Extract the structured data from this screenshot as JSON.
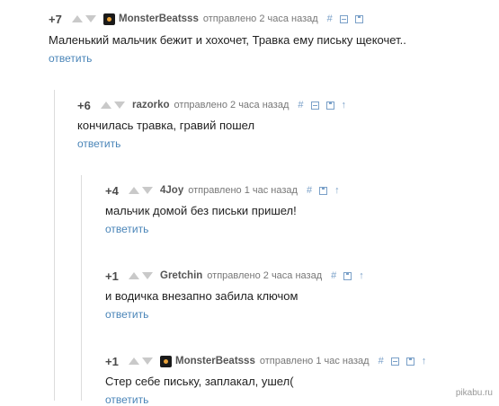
{
  "comments": [
    {
      "score": "+7",
      "author": "MonsterBeatsss",
      "has_avatar": true,
      "meta": "отправлено 2 часа назад",
      "text": "Маленький мальчик бежит и хохочет, Травка ему письку щекочет..",
      "reply": "ответить",
      "tools": [
        "hash",
        "collapse",
        "save"
      ]
    },
    {
      "score": "+6",
      "author": "razorko",
      "has_avatar": false,
      "meta": "отправлено 2 часа назад",
      "text": "кончилась травка, гравий пошел",
      "reply": "ответить",
      "tools": [
        "hash",
        "collapse",
        "save",
        "parent"
      ]
    },
    {
      "score": "+4",
      "author": "4Joy",
      "has_avatar": false,
      "meta": "отправлено 1 час назад",
      "text": "мальчик домой без письки пришел!",
      "reply": "ответить",
      "tools": [
        "hash",
        "save",
        "parent"
      ]
    },
    {
      "score": "+1",
      "author": "Gretchin",
      "has_avatar": false,
      "meta": "отправлено 2 часа назад",
      "text": "и водичка внезапно забила ключом",
      "reply": "ответить",
      "tools": [
        "hash",
        "save",
        "parent"
      ]
    },
    {
      "score": "+1",
      "author": "MonsterBeatsss",
      "has_avatar": true,
      "meta": "отправлено 1 час назад",
      "text": "Стер себе письку, заплакал, ушел(",
      "reply": "ответить",
      "tools": [
        "hash",
        "collapse",
        "save",
        "parent"
      ]
    }
  ],
  "symbols": {
    "hash": "#",
    "parent": "↑"
  },
  "watermark": "pikabu.ru"
}
